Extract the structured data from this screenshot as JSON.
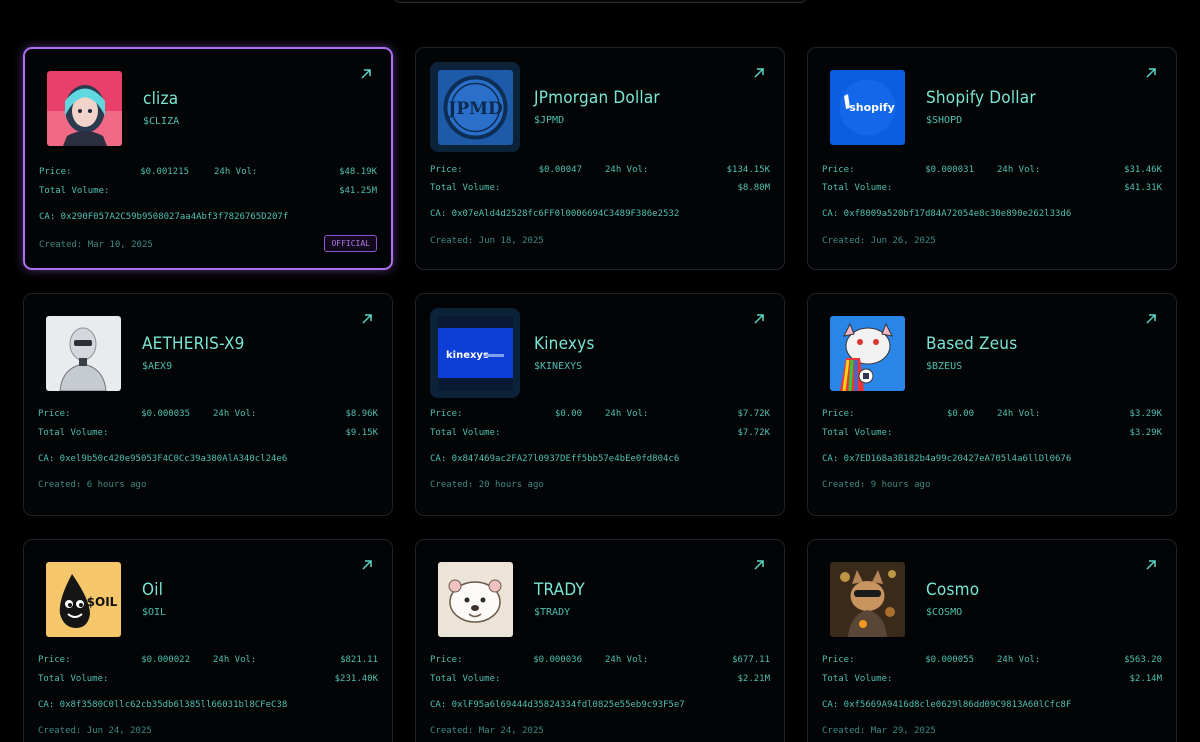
{
  "tokens": [
    {
      "name": "cliza",
      "ticker": "$CLIZA",
      "price_label": "Price:",
      "price": "$0.001215",
      "vol_label": "24h Vol:",
      "vol": "$48.19K",
      "total_label": "Total Volume:",
      "total": "$41.25M",
      "ca": "CA: 0x290F057A2C59b9508027aa4Abf3f7826765D207f",
      "created": "Created: Mar 10, 2025",
      "badge": "OFFICIAL"
    },
    {
      "name": "JPmorgan Dollar",
      "ticker": "$JPMD",
      "price_label": "Price:",
      "price": "$0.00047",
      "vol_label": "24h Vol:",
      "vol": "$134.15K",
      "total_label": "Total Volume:",
      "total": "$8.80M",
      "ca": "CA: 0x07eAld4d2528fc6FF0l0006694C3489F386e2532",
      "created": "Created: Jun 18, 2025"
    },
    {
      "name": "Shopify Dollar",
      "ticker": "$SHOPD",
      "price_label": "Price:",
      "price": "$0.000031",
      "vol_label": "24h Vol:",
      "vol": "$31.46K",
      "total_label": "Total Volume:",
      "total": "$41.31K",
      "ca": "CA: 0xf8009a520bf17d84A72054e8c30e890e262l33d6",
      "created": "Created: Jun 26, 2025"
    },
    {
      "name": "AETHERIS-X9",
      "ticker": "$AEX9",
      "price_label": "Price:",
      "price": "$0.000035",
      "vol_label": "24h Vol:",
      "vol": "$8.96K",
      "total_label": "Total Volume:",
      "total": "$9.15K",
      "ca": "CA: 0xel9b50c420e95053F4C0Cc39a380AlA340cl24e6",
      "created": "Created: 6 hours ago"
    },
    {
      "name": "Kinexys",
      "ticker": "$KINEXYS",
      "price_label": "Price:",
      "price": "$0.00",
      "vol_label": "24h Vol:",
      "vol": "$7.72K",
      "total_label": "Total Volume:",
      "total": "$7.72K",
      "ca": "CA: 0x847469ac2FA27l0937DEff5bb57e4bEe0fd804c6",
      "created": "Created: 20 hours ago"
    },
    {
      "name": "Based Zeus",
      "ticker": "$BZEUS",
      "price_label": "Price:",
      "price": "$0.00",
      "vol_label": "24h Vol:",
      "vol": "$3.29K",
      "total_label": "Total Volume:",
      "total": "$3.29K",
      "ca": "CA: 0x7ED168a3B182b4a99c20427eA705l4a6llDl0676",
      "created": "Created: 9 hours ago"
    },
    {
      "name": "Oil",
      "ticker": "$OIL",
      "price_label": "Price:",
      "price": "$0.000022",
      "vol_label": "24h Vol:",
      "vol": "$821.11",
      "total_label": "Total Volume:",
      "total": "$231.40K",
      "ca": "CA: 0x8f3580C0llc62cb35db6l385ll66031bl8CFeC38",
      "created": "Created: Jun 24, 2025"
    },
    {
      "name": "TRADY",
      "ticker": "$TRADY",
      "price_label": "Price:",
      "price": "$0.000036",
      "vol_label": "24h Vol:",
      "vol": "$677.11",
      "total_label": "Total Volume:",
      "total": "$2.21M",
      "ca": "CA: 0xlF95a6l69444d35824334fdl0825e55eb9c93F5e7",
      "created": "Created: Mar 24, 2025"
    },
    {
      "name": "Cosmo",
      "ticker": "$COSMO",
      "price_label": "Price:",
      "price": "$0.000055",
      "vol_label": "24h Vol:",
      "vol": "$563.20",
      "total_label": "Total Volume:",
      "total": "$2.14M",
      "ca": "CA: 0xf5669A9416d8cle0629l86dd09C9813A60lCfc8F",
      "created": "Created: Mar 29, 2025"
    }
  ],
  "shopify_logo_text": "shopify",
  "jpmd_logo_text": "JPMD",
  "kinexys_logo_text": "kinexys",
  "oil_logo_text": "$OIL",
  "icons": {
    "arrow": "arrow-up-right-icon"
  },
  "colors": {
    "accent": "#5ad6c7",
    "featured_border": "#b06ef3",
    "badge": "#b07be8"
  }
}
